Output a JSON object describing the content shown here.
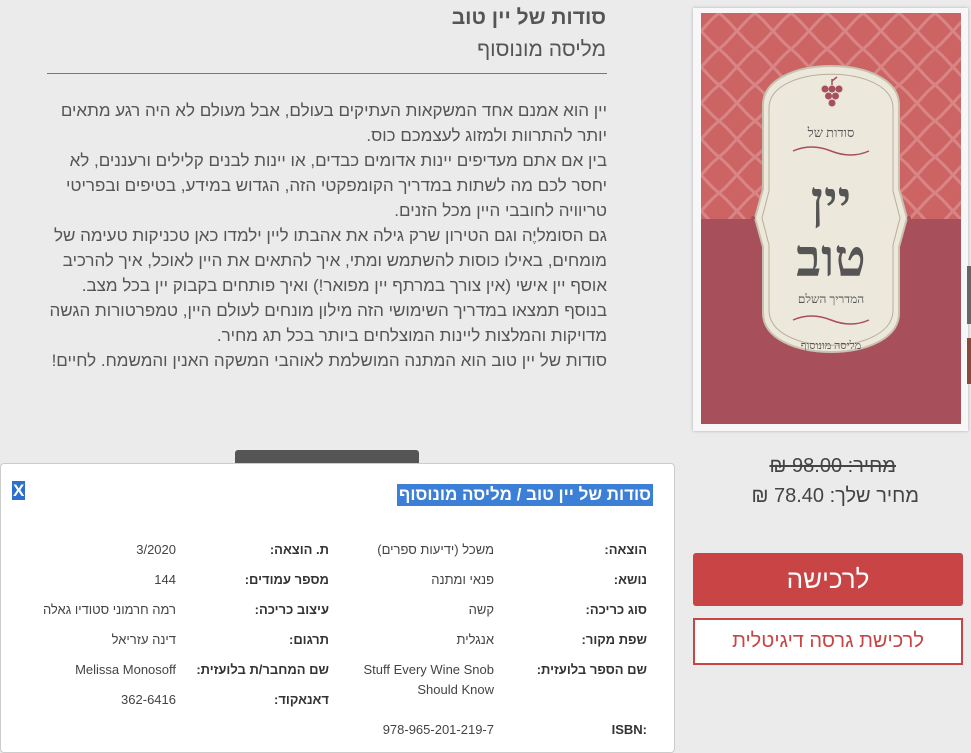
{
  "book": {
    "title": "סודות של יין טוב",
    "author": "מליסה מונוסוף",
    "description": [
      "יין הוא אמנם אחד המשקאות העתיקים בעולם, אבל מעולם לא היה רגע מתאים יותר להתרוות ולמזוג לעצמכם כוס.",
      "בין אם אתם מעדיפים יינות אדומים כבדים, או יינות לבנים קלילים ורעננים, לא יחסר לכם מה לשתות במדריך הקומפקטי הזה, הגדוש במידע, בטיפים ובפריטי טריוויה לחובבי היין מכל הזנים.",
      "גם הסומליֶה וגם הטירון שרק גילה את אהבתו ליין ילמדו כאן טכניקות טעימה של מומחים, באילו כוסות להשתמש ומתי, איך להתאים את היין לאוכל, איך להרכיב אוסף יין אישי (אין צורך במרתף יין מפואר!) ואיך פותחים בקבוק יין בכל מצב.",
      "בנוסף תמצאו במדריך השימושי הזה מילון מונחים לעולם היין, טמפרטורות הגשה מדויקות והמלצות ליינות המוצלחים ביותר בכל תג מחיר.",
      "סודות של יין טוב הוא המתנה המושלמת לאוהבי המשקה האנין והמשמח. לחיים!"
    ]
  },
  "cover": {
    "top_line": "סודות של",
    "word1": "יין",
    "word2": "טוב",
    "subtitle": "המדריך השלם",
    "author": "מליסה מונוסוף",
    "colors": {
      "top": "#cc6464",
      "bottom": "#a84f5c",
      "panel": "#ece8dc",
      "ink": "#555555"
    }
  },
  "price": {
    "original": "מחיר: 98.00 ₪",
    "yours": "מחיר שלך: 78.40 ₪"
  },
  "buttons": {
    "buy": "לרכישה",
    "digital": "לרכישת גרסה דיגיטלית"
  },
  "details": {
    "close": "X",
    "title": "סודות של יין טוב / מליסה מונוסוף",
    "publisher_label": "הוצאה:",
    "publisher": "משכל (ידיעות ספרים)",
    "pub_date_label": "ת. הוצאה:",
    "pub_date": "3/2020",
    "subject_label": "נושא:",
    "subject": "פנאי ומתנה",
    "pages_label": "מספר עמודים:",
    "pages": "144",
    "binding_label": "סוג כריכה:",
    "binding": "קשה",
    "cover_design_label": "עיצוב כריכה:",
    "cover_design": "רמה חרמוני סטודיו גאלה",
    "source_lang_label": "שפת מקור:",
    "source_lang": "אנגלית",
    "translation_label": "תרגום:",
    "translation": "דינה עזריאל",
    "foreign_title_label": "שם הספר בלועזית:",
    "foreign_title": "Stuff Every Wine Snob Should Know",
    "foreign_author_label": "שם המחבר/ת בלועזית:",
    "foreign_author": "Melissa Monosoff",
    "danacode_label": "דאנאקוד:",
    "danacode": "362-6416",
    "isbn_label": "ISBN:",
    "isbn": "978-965-201-219-7"
  },
  "accent": "#c84445",
  "highlight": "#3b7fd6"
}
